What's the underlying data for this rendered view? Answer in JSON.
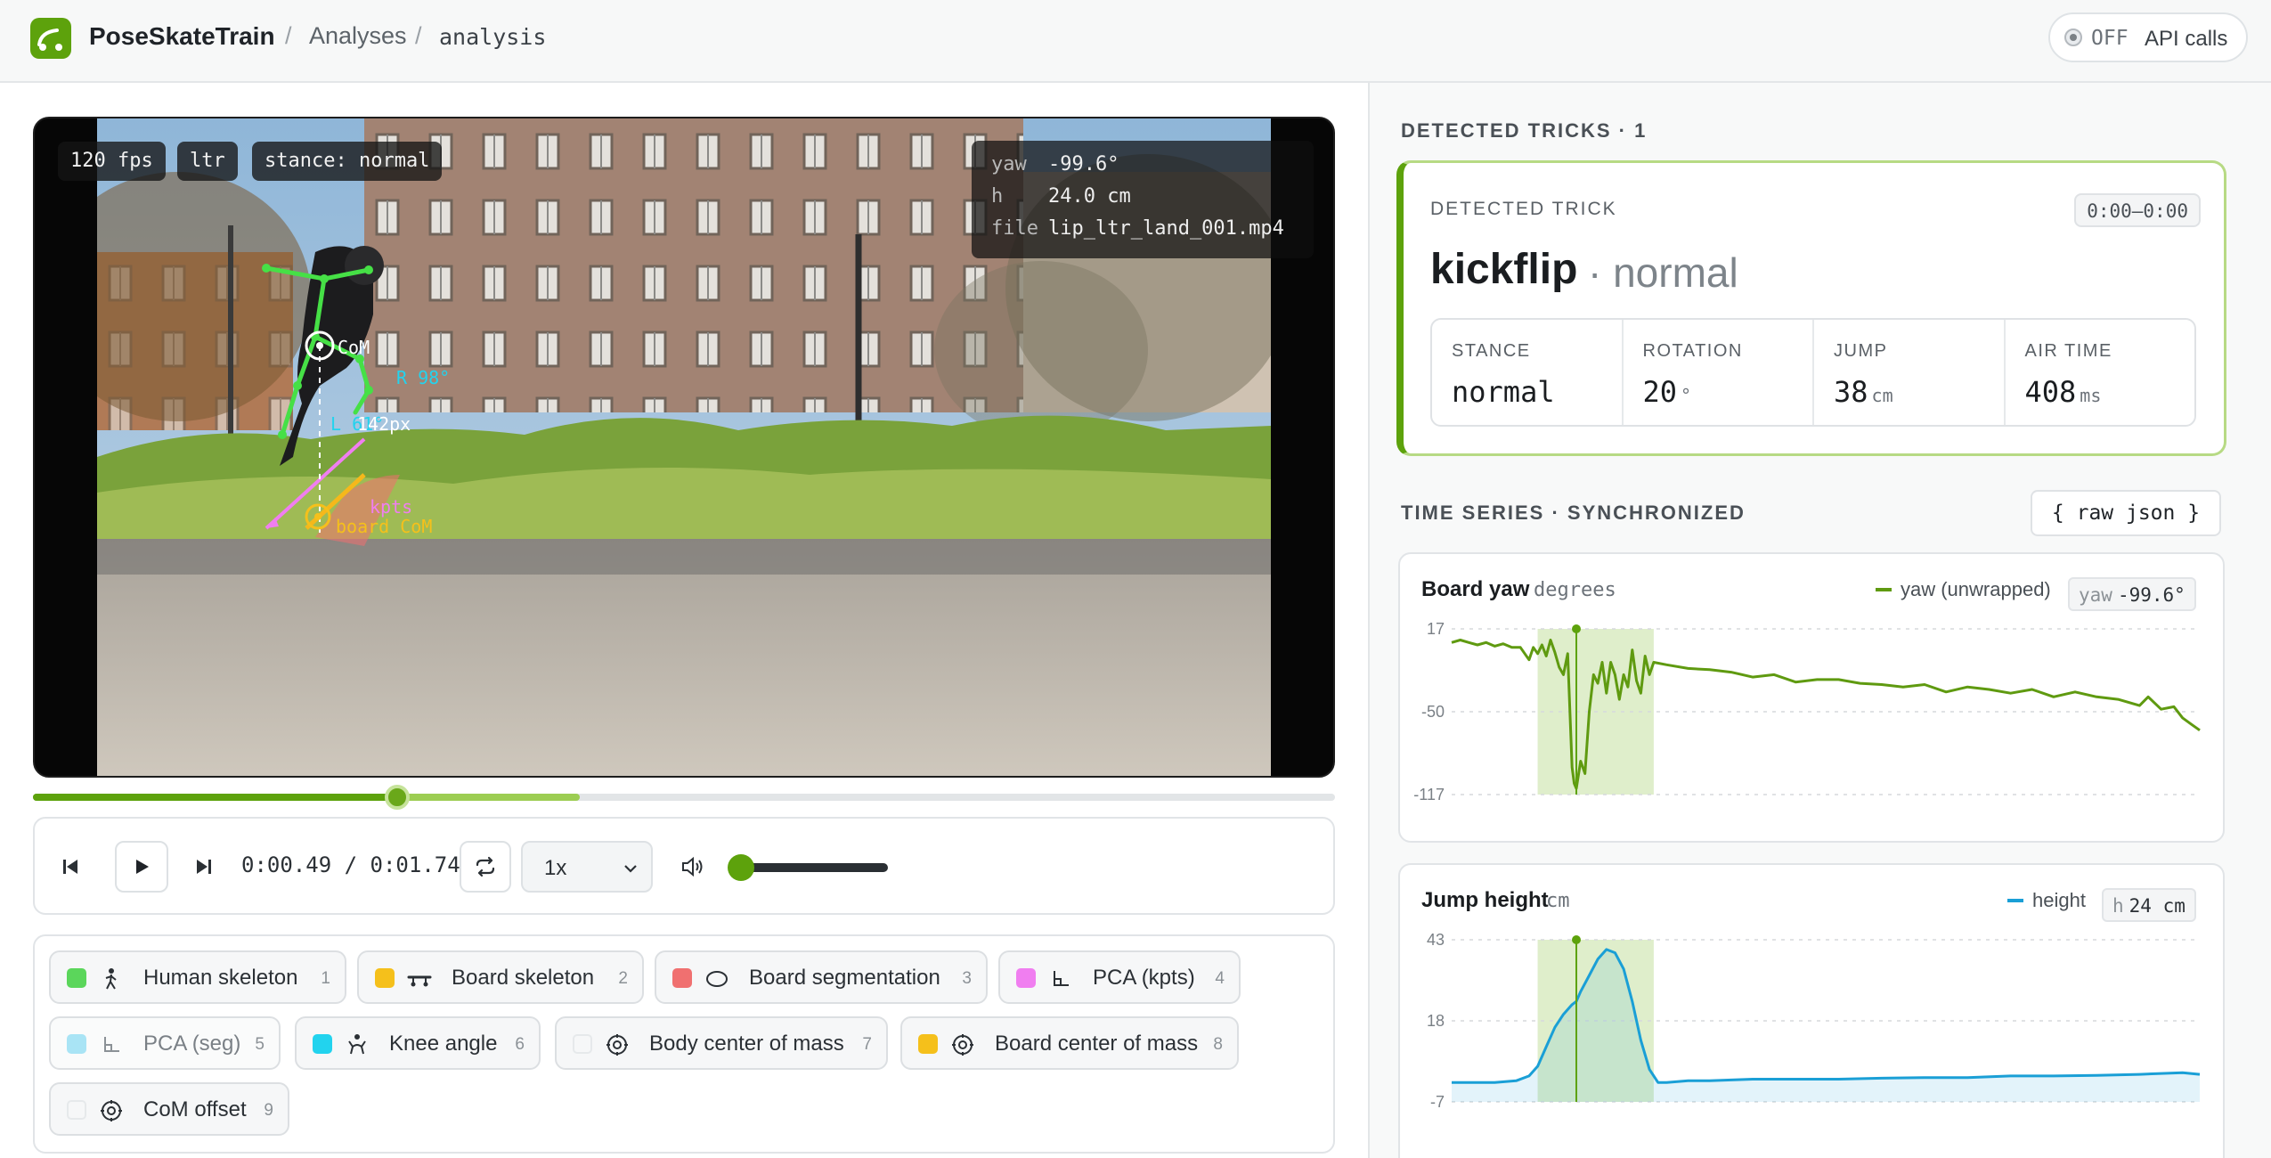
{
  "app": {
    "name": "PoseSkateTrain",
    "breadcrumbs": [
      "Analyses",
      "analysis"
    ],
    "api_state": "OFF",
    "api_label": "API calls",
    "accent": "#5da20c"
  },
  "video": {
    "chips": [
      "120 fps",
      "ltr",
      "stance: normal"
    ],
    "info": [
      {
        "key": "yaw",
        "value": "-99.6°"
      },
      {
        "key": "h",
        "value": "24.0 cm"
      },
      {
        "key": "file",
        "value": "lip_ltr_land_001.mp4"
      }
    ],
    "overlay_labels": {
      "com": "CoM",
      "r_angle": "R 98°",
      "l_angle": "L 61°",
      "px": "142px",
      "kpts": "kpts",
      "board_com": "board CoM"
    },
    "progress_played": 0.28,
    "progress_buffered": 0.42
  },
  "player": {
    "current": "0:00.49",
    "separator": "/",
    "duration": "0:01.74",
    "speed": "1x",
    "volume": 0.0
  },
  "layers": [
    {
      "name": "Human skeleton",
      "num": "1",
      "color": "#5bd65b",
      "icon": "person-icon",
      "on": true
    },
    {
      "name": "Board skeleton",
      "num": "2",
      "color": "#f5c01b",
      "icon": "skateboard-icon",
      "on": true
    },
    {
      "name": "Board segmentation",
      "num": "3",
      "color": "#f07070",
      "icon": "ellipse-icon",
      "on": true
    },
    {
      "name": "PCA (kpts)",
      "num": "4",
      "color": "#f07ef0",
      "icon": "axes-icon",
      "on": true
    },
    {
      "name": "PCA (seg)",
      "num": "5",
      "color": "#a9e4f5",
      "icon": "axes-icon",
      "on": false
    },
    {
      "name": "Knee angle",
      "num": "6",
      "color": "#22d3ee",
      "icon": "knee-icon",
      "on": true
    },
    {
      "name": "Body center of mass",
      "num": "7",
      "color": "",
      "icon": "target-icon",
      "on": true
    },
    {
      "name": "Board center of mass",
      "num": "8",
      "color": "#f5c01b",
      "icon": "target-icon",
      "on": true
    },
    {
      "name": "CoM offset",
      "num": "9",
      "color": "",
      "icon": "target-icon",
      "on": true
    }
  ],
  "tricks": {
    "section_title": "DETECTED TRICKS · 1",
    "card_label": "DETECTED TRICK",
    "time_range": "0:00–0:00",
    "name": "kickflip",
    "stance_suffix": "· normal",
    "stats": [
      {
        "key": "STANCE",
        "value": "normal",
        "unit": ""
      },
      {
        "key": "ROTATION",
        "value": "20",
        "unit": "°"
      },
      {
        "key": "JUMP",
        "value": "38",
        "unit": "cm"
      },
      {
        "key": "AIR TIME",
        "value": "408",
        "unit": "ms"
      }
    ]
  },
  "timeseries": {
    "section_title": "TIME SERIES · SYNCHRONIZED",
    "raw_json": "{ raw json }"
  },
  "chart_data": [
    {
      "type": "line",
      "title": "Board yaw",
      "unit": "degrees",
      "legend": "yaw (unwrapped)",
      "badge_key": "yaw",
      "badge_value": "-99.6°",
      "color": "#5f9a10",
      "ylim": [
        -117,
        17
      ],
      "yticks": [
        "17",
        "-50",
        "-117"
      ],
      "xlim": [
        0,
        1.74
      ],
      "highlight": [
        0.2,
        0.47
      ],
      "cursor": 0.29,
      "series": [
        {
          "name": "yaw (unwrapped)",
          "x": [
            0,
            0.02,
            0.04,
            0.06,
            0.08,
            0.1,
            0.12,
            0.14,
            0.16,
            0.18,
            0.19,
            0.2,
            0.21,
            0.22,
            0.23,
            0.24,
            0.25,
            0.26,
            0.27,
            0.28,
            0.285,
            0.29,
            0.3,
            0.31,
            0.32,
            0.33,
            0.34,
            0.35,
            0.36,
            0.37,
            0.38,
            0.39,
            0.4,
            0.41,
            0.42,
            0.43,
            0.44,
            0.45,
            0.46,
            0.47,
            0.5,
            0.55,
            0.6,
            0.65,
            0.7,
            0.75,
            0.8,
            0.85,
            0.9,
            0.95,
            1.0,
            1.05,
            1.1,
            1.15,
            1.2,
            1.25,
            1.3,
            1.35,
            1.4,
            1.45,
            1.5,
            1.55,
            1.6,
            1.62,
            1.65,
            1.68,
            1.7,
            1.72,
            1.74
          ],
          "y": [
            6,
            8,
            6,
            4,
            6,
            3,
            5,
            2,
            2,
            -8,
            2,
            -3,
            4,
            -5,
            8,
            -2,
            -14,
            -20,
            -3,
            -95,
            -108,
            -112,
            -90,
            -100,
            -50,
            -20,
            -27,
            -10,
            -35,
            -10,
            -20,
            -40,
            -20,
            -30,
            0,
            -25,
            -35,
            -5,
            -20,
            -10,
            -12,
            -15,
            -16,
            -18,
            -22,
            -20,
            -26,
            -24,
            -24,
            -27,
            -28,
            -30,
            -28,
            -34,
            -30,
            -32,
            -35,
            -32,
            -38,
            -34,
            -38,
            -40,
            -45,
            -38,
            -48,
            -46,
            -55,
            -60,
            -65
          ]
        }
      ]
    },
    {
      "type": "area",
      "title": "Jump height",
      "unit": "cm",
      "legend": "height",
      "badge_key": "h",
      "badge_value": "24 cm",
      "color": "#1a9fd6",
      "ylim": [
        -7,
        43
      ],
      "yticks": [
        "43",
        "18",
        "-7"
      ],
      "xlim": [
        0,
        1.74
      ],
      "highlight": [
        0.2,
        0.47
      ],
      "cursor": 0.29,
      "series": [
        {
          "name": "height",
          "x": [
            0,
            0.05,
            0.1,
            0.15,
            0.18,
            0.2,
            0.22,
            0.24,
            0.26,
            0.28,
            0.29,
            0.3,
            0.32,
            0.34,
            0.36,
            0.38,
            0.4,
            0.42,
            0.44,
            0.46,
            0.48,
            0.5,
            0.55,
            0.6,
            0.7,
            0.8,
            0.9,
            1.0,
            1.1,
            1.2,
            1.3,
            1.4,
            1.5,
            1.6,
            1.7,
            1.74
          ],
          "y": [
            -1,
            -1,
            -1,
            -0.5,
            1,
            4,
            10,
            16,
            20,
            23,
            24,
            27,
            32,
            37,
            40,
            39,
            34,
            24,
            12,
            3,
            -1,
            -1,
            -0.5,
            -0.5,
            0,
            0,
            0,
            0.3,
            0.5,
            0.5,
            1,
            1,
            1.2,
            1.5,
            2,
            1.5
          ]
        }
      ]
    }
  ]
}
